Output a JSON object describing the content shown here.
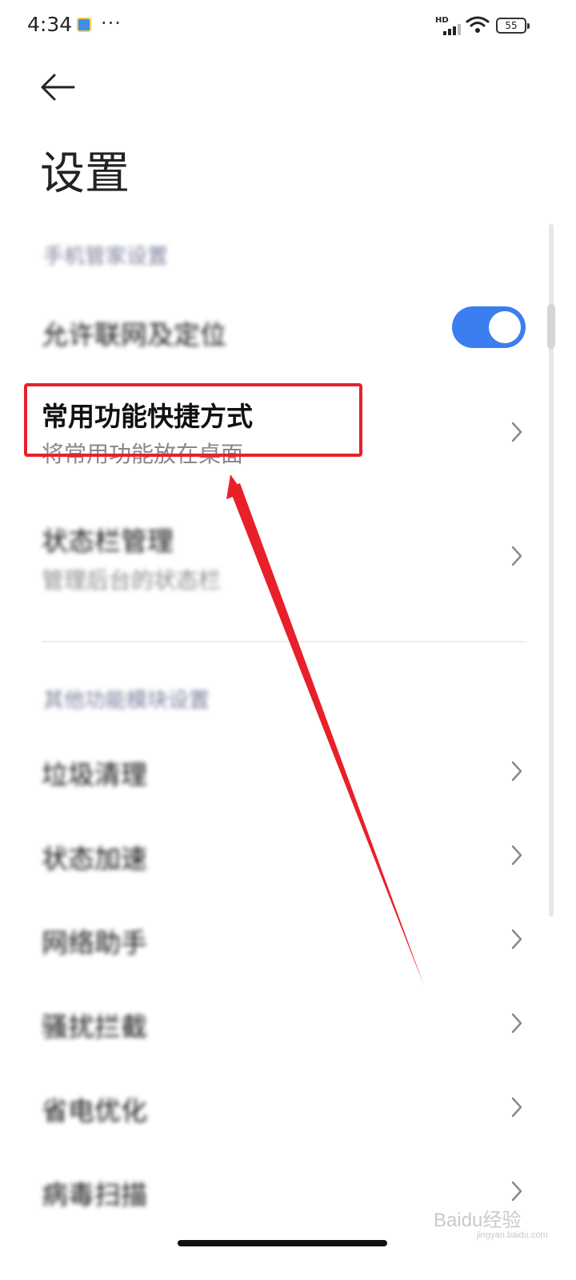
{
  "status_bar": {
    "time": "4:34",
    "more": "···",
    "network_label": "HD",
    "battery": "55"
  },
  "header": {
    "back_icon": "arrow-left-icon",
    "title": "设置"
  },
  "section1": {
    "header": "手机管家设置",
    "toggle_item": {
      "label": "允许联网及定位",
      "enabled": true
    },
    "shortcut_item": {
      "title": "常用功能快捷方式",
      "subtitle": "将常用功能放在桌面"
    },
    "item3": {
      "title": "状态栏管理",
      "subtitle": "管理后台的状态栏"
    }
  },
  "section2": {
    "header": "其他功能模块设置",
    "items": [
      "垃圾清理",
      "状态加速",
      "网络助手",
      "骚扰拦截",
      "省电优化",
      "病毒扫描"
    ]
  },
  "watermark": {
    "text": "Baidu经验",
    "sub": "jingyan.baidu.com"
  },
  "colors": {
    "accent": "#3a7ef0",
    "annotation": "#e8202a"
  }
}
